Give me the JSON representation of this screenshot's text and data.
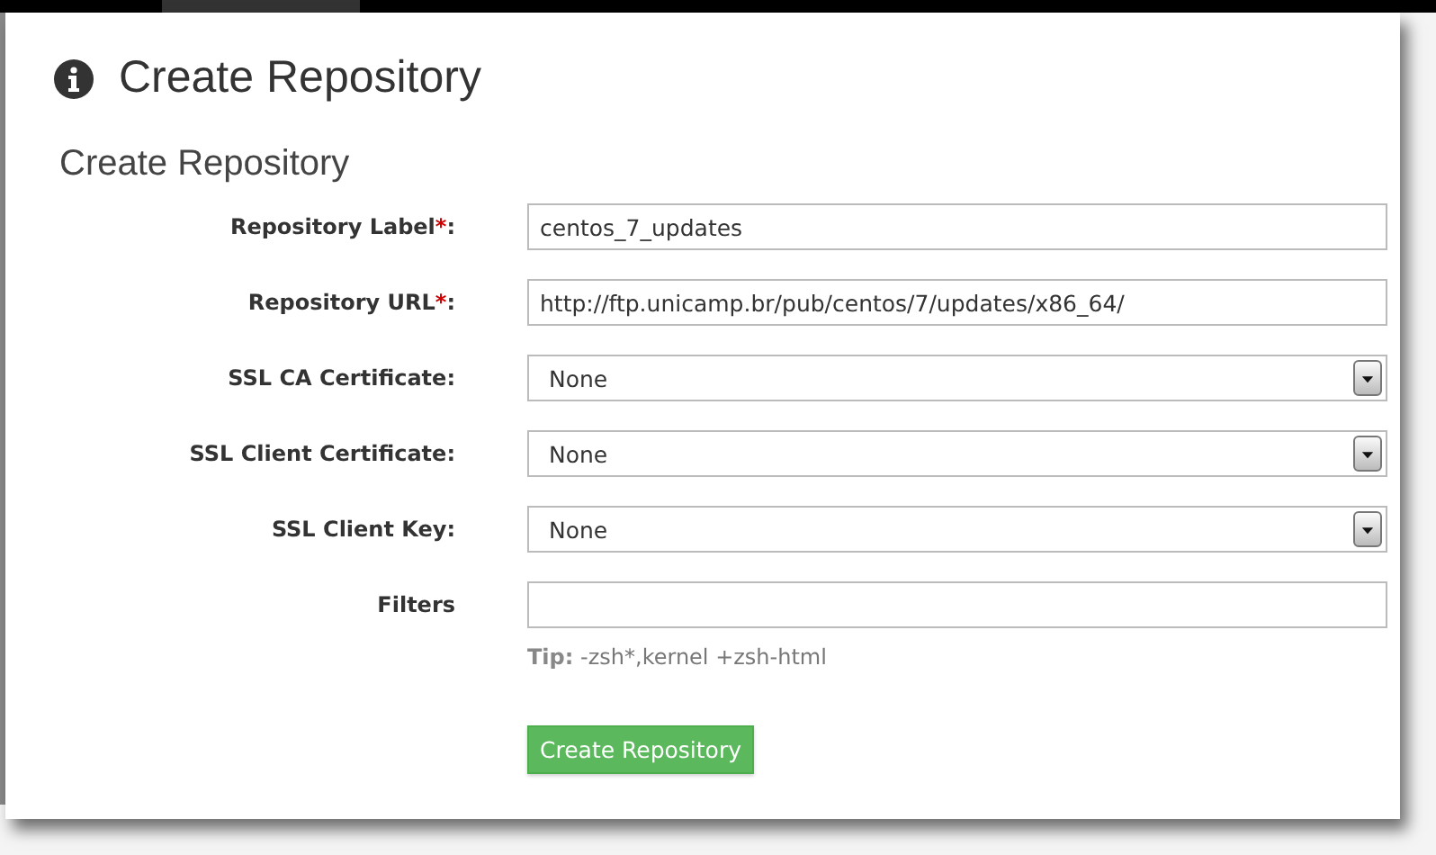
{
  "page_title": "Create Repository",
  "section_title": "Create Repository",
  "fields": [
    {
      "kind": "text",
      "label": "Repository Label",
      "required_mark": "*",
      "colon": ":",
      "value": "centos_7_updates"
    },
    {
      "kind": "text",
      "label": "Repository URL",
      "required_mark": "*",
      "colon": ":",
      "value": "http://ftp.unicamp.br/pub/centos/7/updates/x86_64/"
    },
    {
      "kind": "select",
      "label": "SSL CA Certificate",
      "colon": ":",
      "value": "None"
    },
    {
      "kind": "select",
      "label": "SSL Client Certificate",
      "colon": ":",
      "value": "None"
    },
    {
      "kind": "select",
      "label": "SSL Client Key",
      "colon": ":",
      "value": "None"
    },
    {
      "kind": "text",
      "label": "Filters"
    }
  ],
  "tip": {
    "label": "Tip:",
    "text": "-zsh*,kernel +zsh-html"
  },
  "submit_button": "Create Repository"
}
